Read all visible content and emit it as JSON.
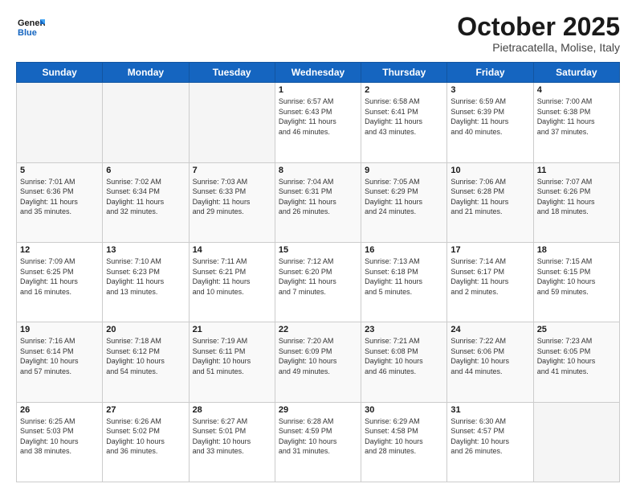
{
  "logo": {
    "line1": "General",
    "line2": "Blue"
  },
  "header": {
    "month": "October 2025",
    "location": "Pietracatella, Molise, Italy"
  },
  "weekdays": [
    "Sunday",
    "Monday",
    "Tuesday",
    "Wednesday",
    "Thursday",
    "Friday",
    "Saturday"
  ],
  "weeks": [
    [
      {
        "day": null,
        "info": null
      },
      {
        "day": null,
        "info": null
      },
      {
        "day": null,
        "info": null
      },
      {
        "day": "1",
        "info": "Sunrise: 6:57 AM\nSunset: 6:43 PM\nDaylight: 11 hours\nand 46 minutes."
      },
      {
        "day": "2",
        "info": "Sunrise: 6:58 AM\nSunset: 6:41 PM\nDaylight: 11 hours\nand 43 minutes."
      },
      {
        "day": "3",
        "info": "Sunrise: 6:59 AM\nSunset: 6:39 PM\nDaylight: 11 hours\nand 40 minutes."
      },
      {
        "day": "4",
        "info": "Sunrise: 7:00 AM\nSunset: 6:38 PM\nDaylight: 11 hours\nand 37 minutes."
      }
    ],
    [
      {
        "day": "5",
        "info": "Sunrise: 7:01 AM\nSunset: 6:36 PM\nDaylight: 11 hours\nand 35 minutes."
      },
      {
        "day": "6",
        "info": "Sunrise: 7:02 AM\nSunset: 6:34 PM\nDaylight: 11 hours\nand 32 minutes."
      },
      {
        "day": "7",
        "info": "Sunrise: 7:03 AM\nSunset: 6:33 PM\nDaylight: 11 hours\nand 29 minutes."
      },
      {
        "day": "8",
        "info": "Sunrise: 7:04 AM\nSunset: 6:31 PM\nDaylight: 11 hours\nand 26 minutes."
      },
      {
        "day": "9",
        "info": "Sunrise: 7:05 AM\nSunset: 6:29 PM\nDaylight: 11 hours\nand 24 minutes."
      },
      {
        "day": "10",
        "info": "Sunrise: 7:06 AM\nSunset: 6:28 PM\nDaylight: 11 hours\nand 21 minutes."
      },
      {
        "day": "11",
        "info": "Sunrise: 7:07 AM\nSunset: 6:26 PM\nDaylight: 11 hours\nand 18 minutes."
      }
    ],
    [
      {
        "day": "12",
        "info": "Sunrise: 7:09 AM\nSunset: 6:25 PM\nDaylight: 11 hours\nand 16 minutes."
      },
      {
        "day": "13",
        "info": "Sunrise: 7:10 AM\nSunset: 6:23 PM\nDaylight: 11 hours\nand 13 minutes."
      },
      {
        "day": "14",
        "info": "Sunrise: 7:11 AM\nSunset: 6:21 PM\nDaylight: 11 hours\nand 10 minutes."
      },
      {
        "day": "15",
        "info": "Sunrise: 7:12 AM\nSunset: 6:20 PM\nDaylight: 11 hours\nand 7 minutes."
      },
      {
        "day": "16",
        "info": "Sunrise: 7:13 AM\nSunset: 6:18 PM\nDaylight: 11 hours\nand 5 minutes."
      },
      {
        "day": "17",
        "info": "Sunrise: 7:14 AM\nSunset: 6:17 PM\nDaylight: 11 hours\nand 2 minutes."
      },
      {
        "day": "18",
        "info": "Sunrise: 7:15 AM\nSunset: 6:15 PM\nDaylight: 10 hours\nand 59 minutes."
      }
    ],
    [
      {
        "day": "19",
        "info": "Sunrise: 7:16 AM\nSunset: 6:14 PM\nDaylight: 10 hours\nand 57 minutes."
      },
      {
        "day": "20",
        "info": "Sunrise: 7:18 AM\nSunset: 6:12 PM\nDaylight: 10 hours\nand 54 minutes."
      },
      {
        "day": "21",
        "info": "Sunrise: 7:19 AM\nSunset: 6:11 PM\nDaylight: 10 hours\nand 51 minutes."
      },
      {
        "day": "22",
        "info": "Sunrise: 7:20 AM\nSunset: 6:09 PM\nDaylight: 10 hours\nand 49 minutes."
      },
      {
        "day": "23",
        "info": "Sunrise: 7:21 AM\nSunset: 6:08 PM\nDaylight: 10 hours\nand 46 minutes."
      },
      {
        "day": "24",
        "info": "Sunrise: 7:22 AM\nSunset: 6:06 PM\nDaylight: 10 hours\nand 44 minutes."
      },
      {
        "day": "25",
        "info": "Sunrise: 7:23 AM\nSunset: 6:05 PM\nDaylight: 10 hours\nand 41 minutes."
      }
    ],
    [
      {
        "day": "26",
        "info": "Sunrise: 6:25 AM\nSunset: 5:03 PM\nDaylight: 10 hours\nand 38 minutes."
      },
      {
        "day": "27",
        "info": "Sunrise: 6:26 AM\nSunset: 5:02 PM\nDaylight: 10 hours\nand 36 minutes."
      },
      {
        "day": "28",
        "info": "Sunrise: 6:27 AM\nSunset: 5:01 PM\nDaylight: 10 hours\nand 33 minutes."
      },
      {
        "day": "29",
        "info": "Sunrise: 6:28 AM\nSunset: 4:59 PM\nDaylight: 10 hours\nand 31 minutes."
      },
      {
        "day": "30",
        "info": "Sunrise: 6:29 AM\nSunset: 4:58 PM\nDaylight: 10 hours\nand 28 minutes."
      },
      {
        "day": "31",
        "info": "Sunrise: 6:30 AM\nSunset: 4:57 PM\nDaylight: 10 hours\nand 26 minutes."
      },
      {
        "day": null,
        "info": null
      }
    ]
  ]
}
